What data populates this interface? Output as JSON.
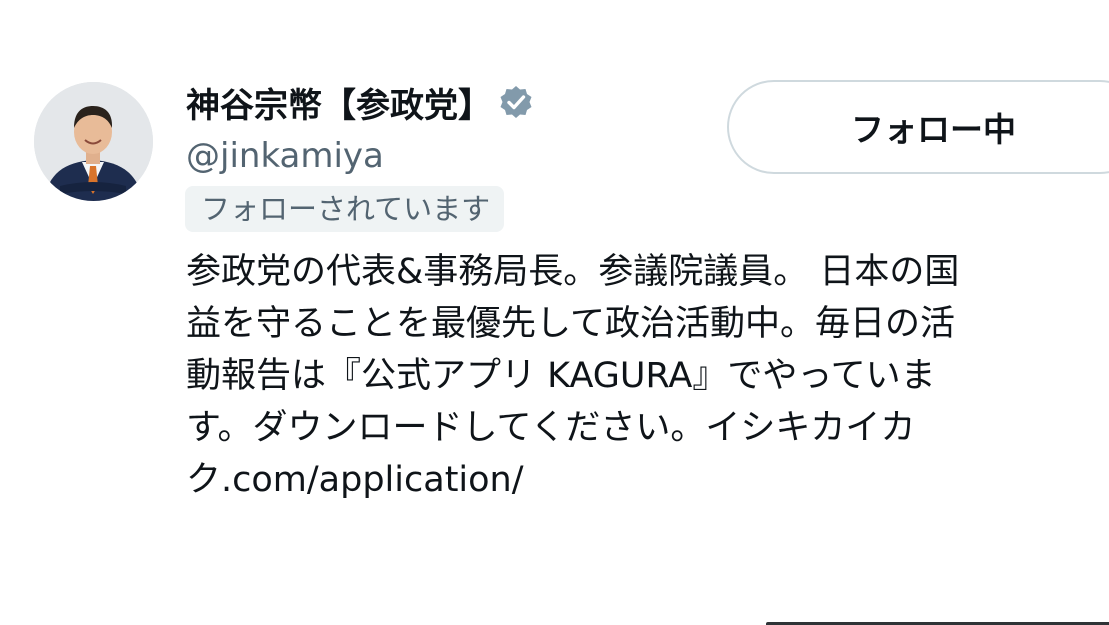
{
  "profile": {
    "display_name": "神谷宗幣【参政党】",
    "handle": "@jinkamiya",
    "follows_you": "フォローされています",
    "verified_icon": "verified-badge-icon",
    "verified_color": "#829aab"
  },
  "actions": {
    "follow_label": "フォロー中"
  },
  "bio": {
    "lines": [
      "参政党の代表&事務局長。参議院議員。 日本の国",
      "益を守ることを最優先して政治活動中。毎日の活",
      "動報告は『公式アプリ KAGURA』でやっていま",
      "す。ダウンロードしてください。イシキカイカ",
      "ク.com/application/"
    ]
  },
  "colors": {
    "text_primary": "#0f1419",
    "text_secondary": "#536471",
    "pill_background": "#eff3f4",
    "button_border": "#cfd9de"
  }
}
